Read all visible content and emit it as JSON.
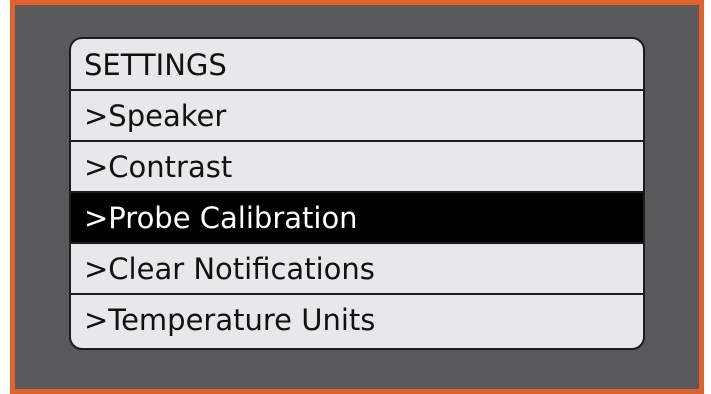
{
  "colors": {
    "bezel_border": "#e2622b",
    "bezel_fill": "#58595b",
    "screen_background": "#e7e8e9",
    "selected_background": "#000000",
    "selected_text": "#ffffff"
  },
  "menu": {
    "title": "SETTINGS",
    "selected_index": 2,
    "items": [
      {
        "label": ">Speaker"
      },
      {
        "label": ">Contrast"
      },
      {
        "label": ">Probe Calibration"
      },
      {
        "label": ">Clear Notifications"
      },
      {
        "label": ">Temperature Units"
      }
    ]
  }
}
